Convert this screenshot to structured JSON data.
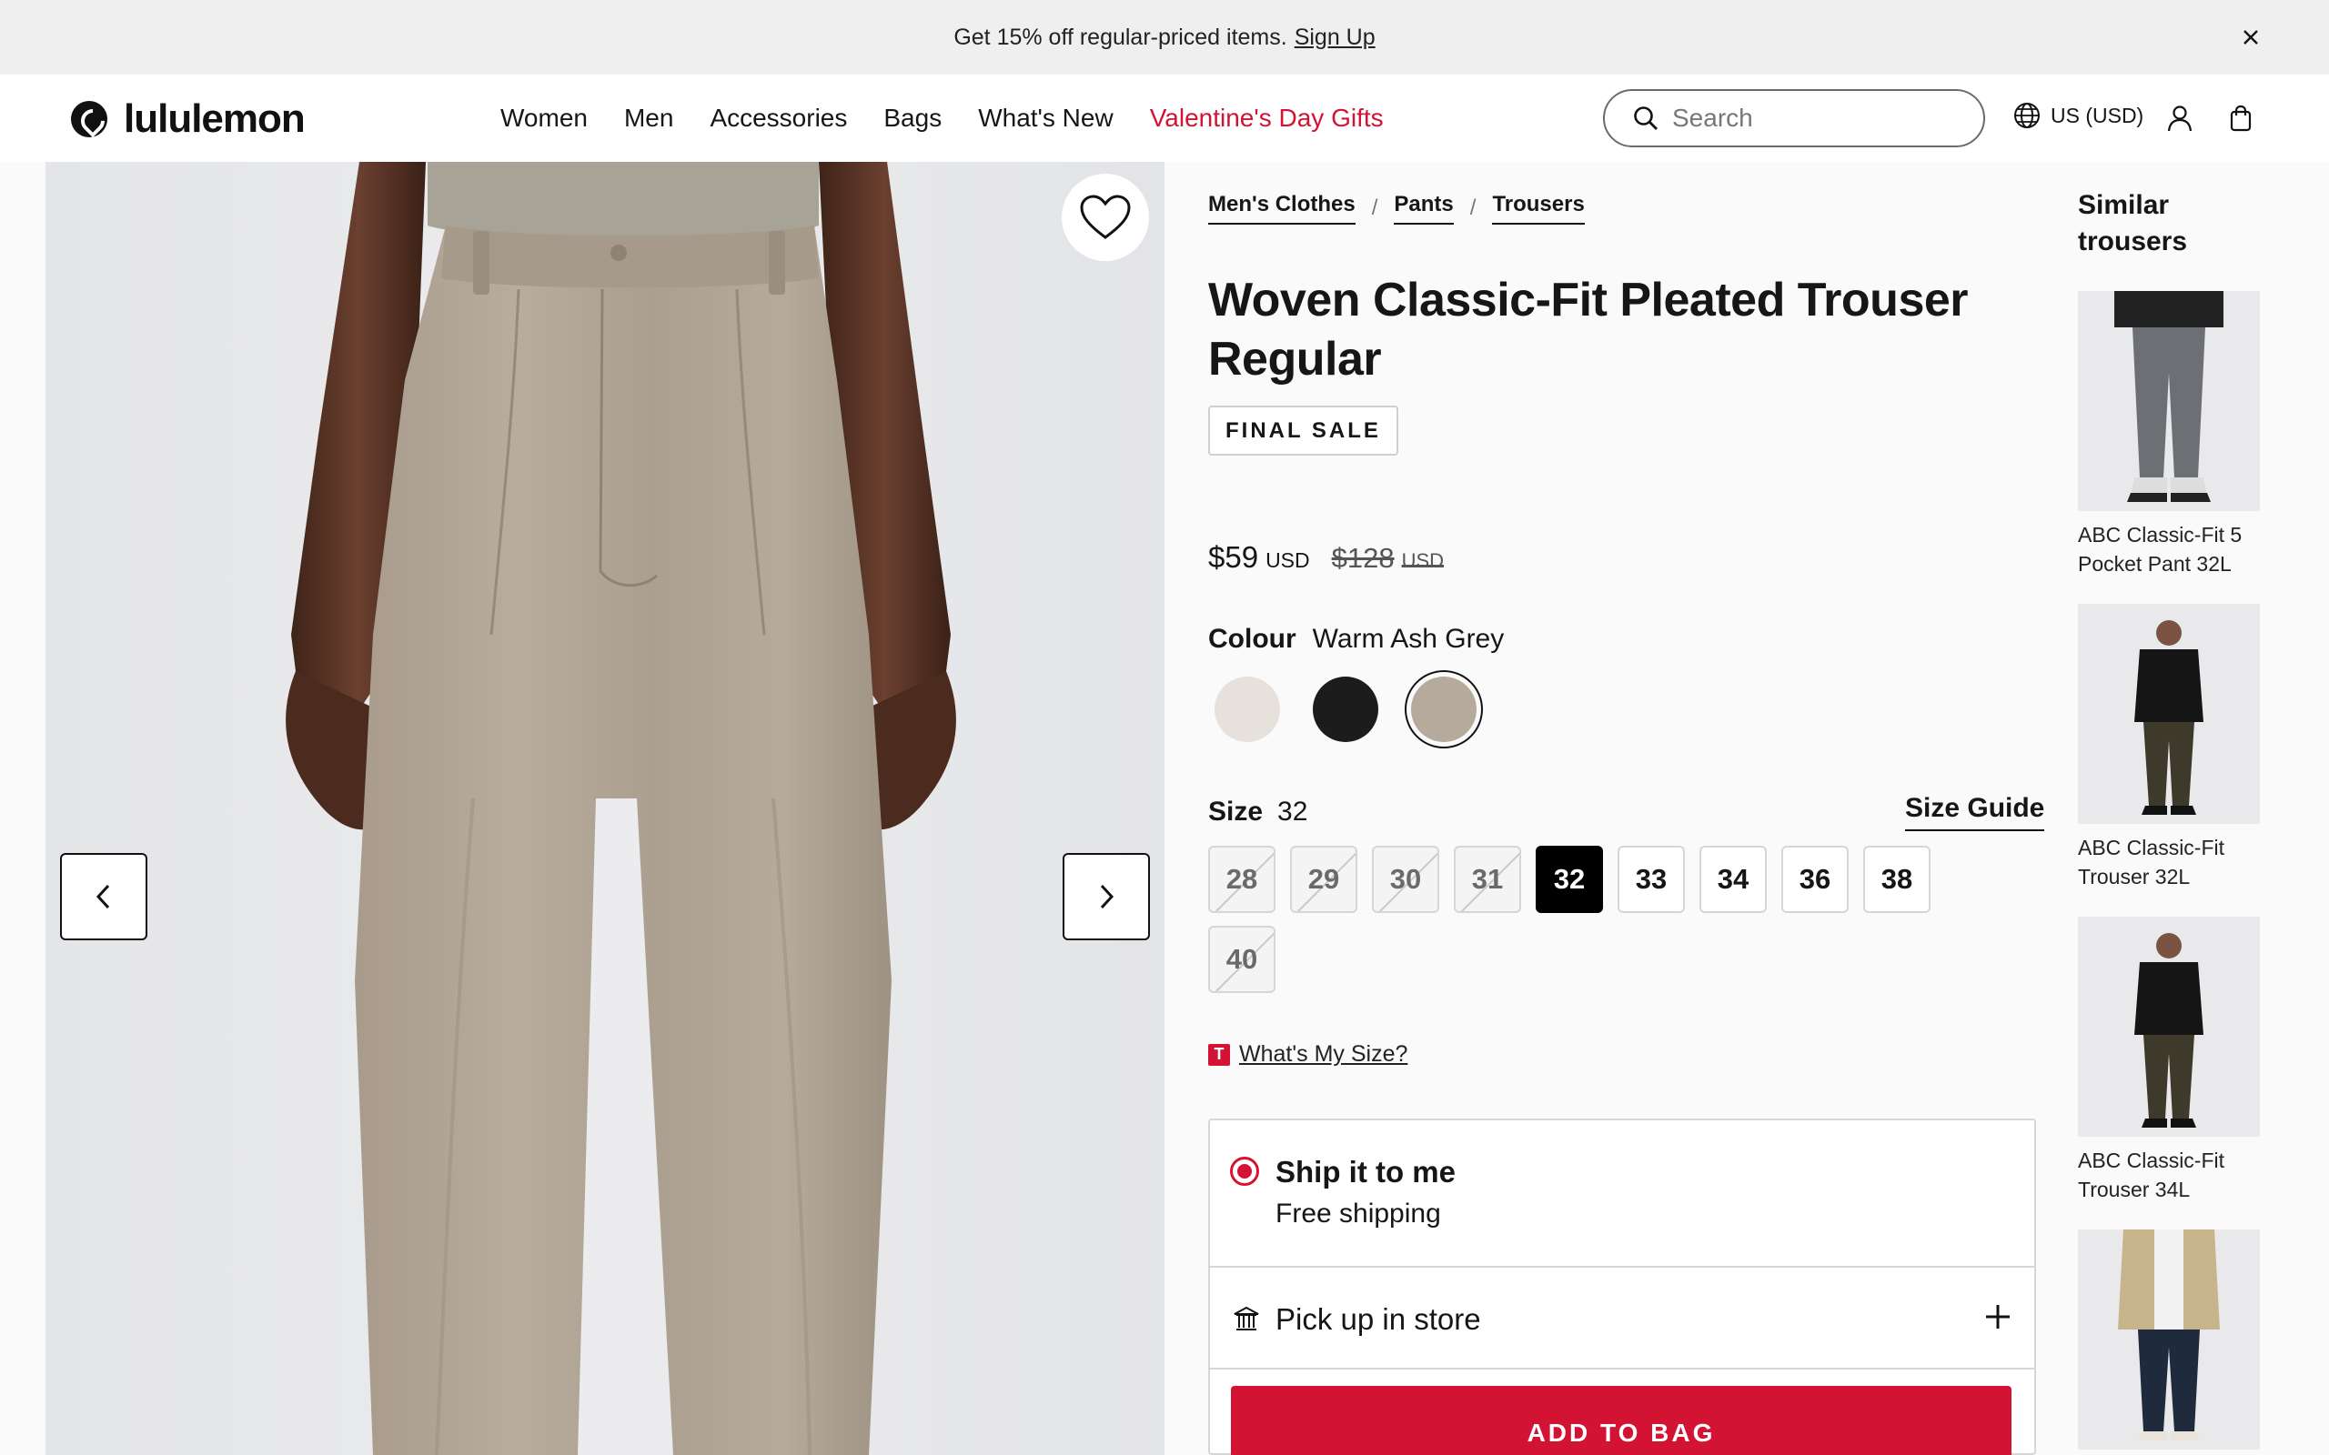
{
  "promo": {
    "text": "Get 15% off regular-priced items.",
    "link": "Sign Up"
  },
  "header": {
    "logo_text": "lululemon",
    "nav": [
      "Women",
      "Men",
      "Accessories",
      "Bags",
      "What's New",
      "Valentine's Day Gifts"
    ],
    "search_placeholder": "Search",
    "locale": "US (USD)"
  },
  "breadcrumb": [
    "Men's Clothes",
    "Pants",
    "Trousers"
  ],
  "product": {
    "title": "Woven Classic-Fit Pleated Trouser Regular",
    "badge": "FINAL SALE",
    "price": "$59",
    "currency": "USD",
    "old_price": "$128",
    "old_currency": "USD"
  },
  "colour": {
    "label": "Colour",
    "selected": "Warm Ash Grey",
    "swatches": [
      {
        "color": "#e6e1da"
      },
      {
        "color": "#1c1c1c"
      },
      {
        "color": "#b5aa9c"
      }
    ]
  },
  "size": {
    "label": "Size",
    "selected": "32",
    "guide": "Size Guide",
    "options": [
      "28",
      "29",
      "30",
      "31",
      "32",
      "33",
      "34",
      "36",
      "38",
      "40"
    ],
    "unavailable": [
      "28",
      "29",
      "30",
      "31",
      "40"
    ]
  },
  "whats_my_size": {
    "badge": "T",
    "text": "What's My Size?"
  },
  "fulfilment": {
    "ship_title": "Ship it to me",
    "ship_sub": "Free shipping",
    "pickup": "Pick up in store"
  },
  "add_to_bag": "ADD TO BAG",
  "similar": {
    "title": "Similar trousers",
    "items": [
      {
        "name": "ABC Classic-Fit 5 Pocket Pant 32L"
      },
      {
        "name": "ABC Classic-Fit Trouser 32L"
      },
      {
        "name": "ABC Classic-Fit Trouser 34L"
      },
      {
        "name": ""
      }
    ]
  },
  "colors": {
    "accent": "#d31334",
    "text": "#161616"
  }
}
